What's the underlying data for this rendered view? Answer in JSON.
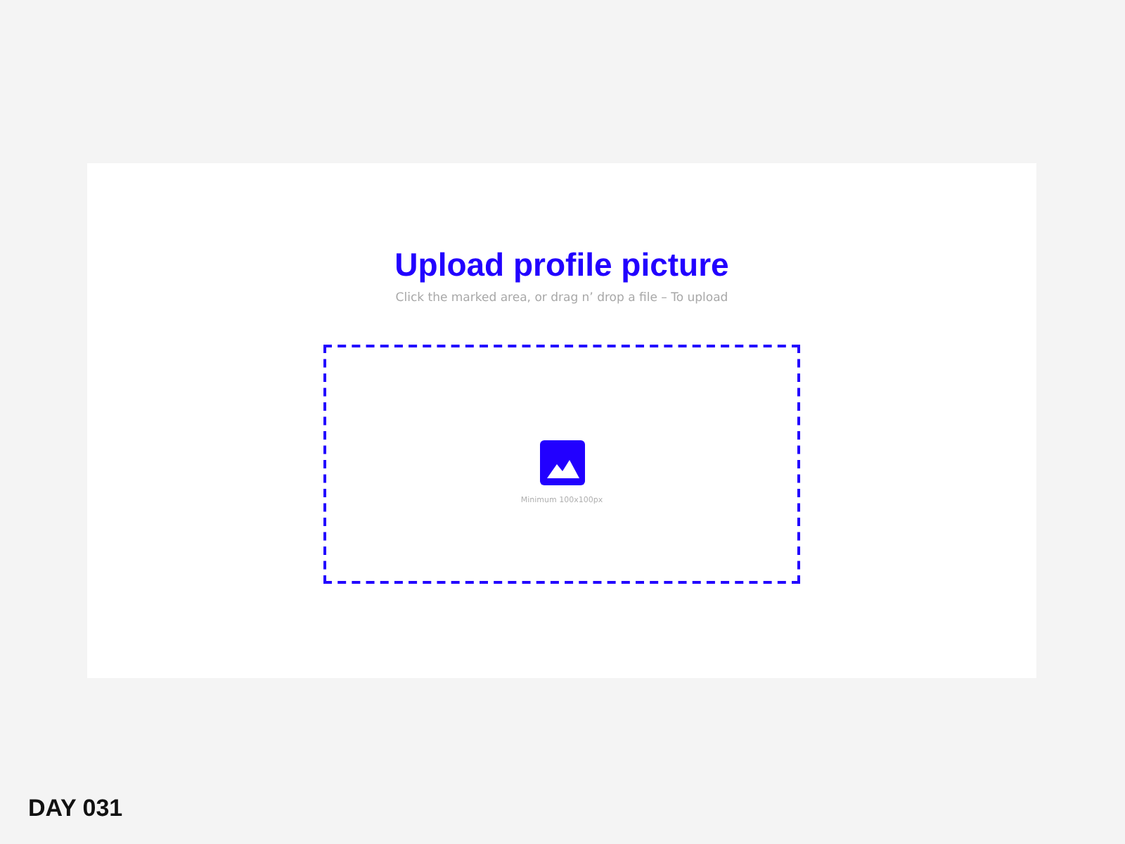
{
  "card": {
    "title": "Upload profile picture",
    "subtitle": "Click the marked area, or drag n’ drop a file – To upload",
    "dropzone": {
      "caption": "Minimum 100x100px"
    }
  },
  "footer": {
    "label": "DAY 031"
  }
}
